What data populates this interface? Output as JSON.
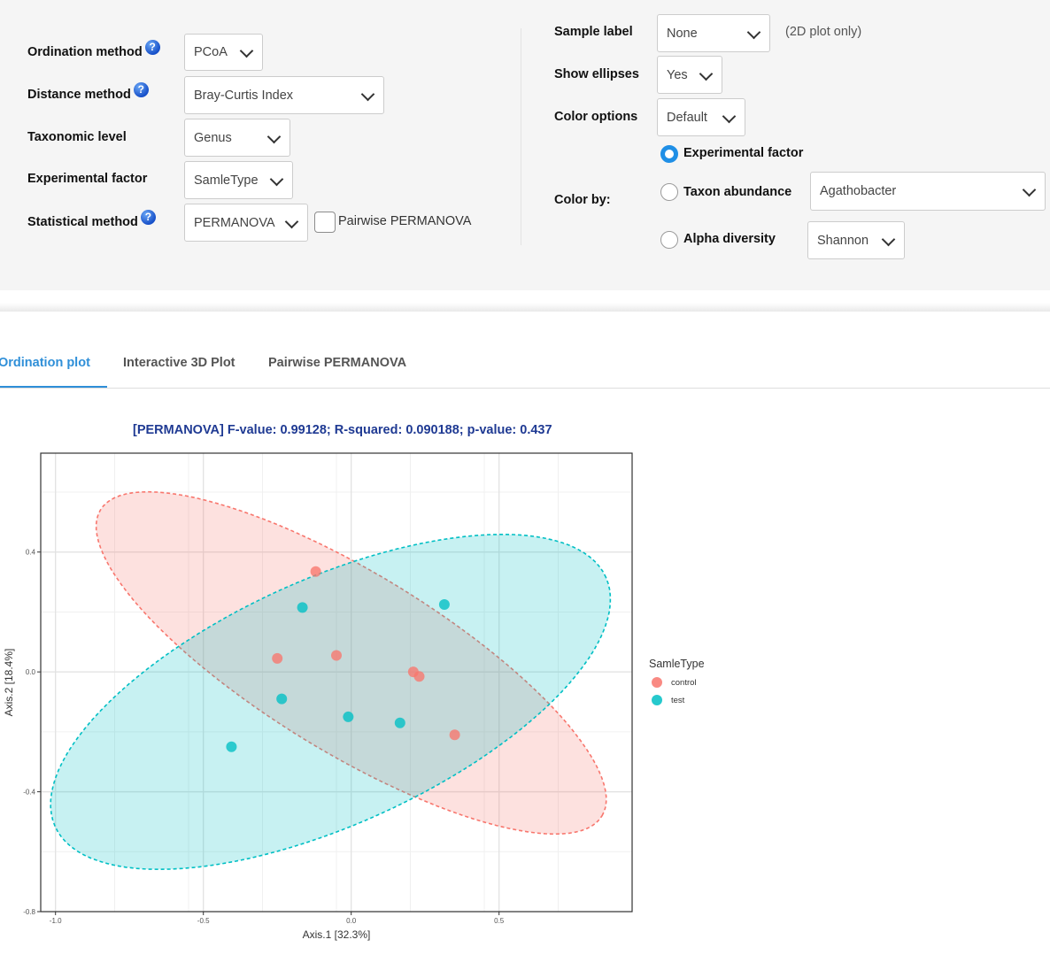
{
  "controls": {
    "ordination_method": {
      "label": "Ordination method",
      "value": "PCoA"
    },
    "distance_method": {
      "label": "Distance method",
      "value": "Bray-Curtis Index"
    },
    "taxonomic_level": {
      "label": "Taxonomic level",
      "value": "Genus"
    },
    "experimental_factor": {
      "label": "Experimental factor",
      "value": "SamleType"
    },
    "statistical_method": {
      "label": "Statistical method",
      "value": "PERMANOVA"
    },
    "pairwise_checkbox": {
      "label": "Pairwise PERMANOVA",
      "checked": false
    },
    "help_icon": "?",
    "sample_label": {
      "label": "Sample label",
      "value": "None",
      "note": "(2D plot only)"
    },
    "show_ellipses": {
      "label": "Show ellipses",
      "value": "Yes"
    },
    "color_options": {
      "label": "Color options",
      "value": "Default"
    },
    "color_by": {
      "label": "Color by:",
      "options": [
        {
          "label": "Experimental factor",
          "selected": true
        },
        {
          "label": "Taxon abundance",
          "selected": false,
          "select_value": "Agathobacter"
        },
        {
          "label": "Alpha diversity",
          "selected": false,
          "select_value": "Shannon"
        }
      ]
    }
  },
  "tabs": [
    {
      "label": "Ordination plot",
      "active": true
    },
    {
      "label": "Interactive 3D Plot",
      "active": false
    },
    {
      "label": "Pairwise PERMANOVA",
      "active": false
    }
  ],
  "chart_data": {
    "type": "scatter",
    "title": "[PERMANOVA] F-value: 0.99128; R-squared: 0.090188; p-value: 0.437",
    "xlabel": "Axis.1   [32.3%]",
    "ylabel": "Axis.2   [18.4%]",
    "xlim": [
      -1.05,
      0.95
    ],
    "ylim": [
      -0.8,
      0.73
    ],
    "x_ticks": [
      -1.0,
      -0.5,
      0.0,
      0.5
    ],
    "x_tick_labels": [
      "-1.0",
      "-0.5",
      "0.0",
      "0.5"
    ],
    "y_ticks": [
      -0.8,
      -0.4,
      0.0,
      0.4
    ],
    "y_tick_labels": [
      "-0.8",
      "-0.4",
      "0.0",
      "0.4"
    ],
    "grid": true,
    "legend": {
      "title": "SamleType",
      "placement": "right"
    },
    "series": [
      {
        "name": "control",
        "color": "#F8766D",
        "points": [
          [
            -0.12,
            0.335
          ],
          [
            -0.25,
            0.045
          ],
          [
            -0.05,
            0.055
          ],
          [
            0.21,
            0.0
          ],
          [
            0.23,
            -0.015
          ],
          [
            0.35,
            -0.21
          ]
        ],
        "ellipse": {
          "center": [
            0.0,
            0.03
          ],
          "semi_axes": [
            0.99,
            0.3
          ],
          "angle_deg": -31
        }
      },
      {
        "name": "test",
        "color": "#00BFC4",
        "points": [
          [
            -0.165,
            0.215
          ],
          [
            0.315,
            0.225
          ],
          [
            -0.235,
            -0.09
          ],
          [
            -0.01,
            -0.15
          ],
          [
            0.165,
            -0.17
          ],
          [
            -0.405,
            -0.25
          ]
        ],
        "ellipse": {
          "center": [
            -0.07,
            -0.1
          ],
          "semi_axes": [
            1.02,
            0.41
          ],
          "angle_deg": 24
        }
      }
    ]
  }
}
